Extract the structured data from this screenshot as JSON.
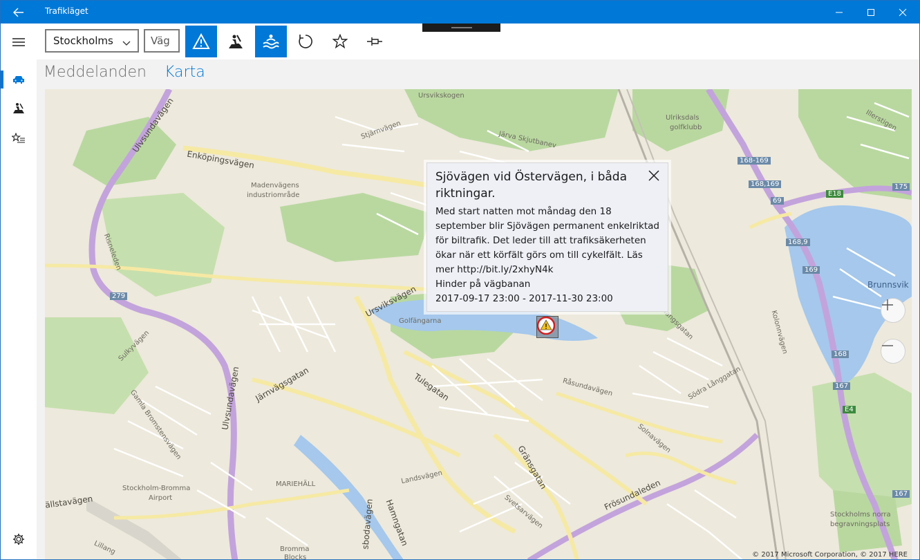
{
  "app": {
    "title": "Trafikläget"
  },
  "toolbar": {
    "region_value": "Stockholms",
    "road_placeholder": "Väg"
  },
  "tabs": [
    {
      "label": "Meddelanden",
      "selected": false
    },
    {
      "label": "Karta",
      "selected": true
    }
  ],
  "popup": {
    "title": "Sjövägen vid Östervägen, i båda riktningar.",
    "description": "Med start natten mot måndag den 18 september blir Sjövägen permanent enkelriktad för biltrafik. Det leder till att trafiksäkerheten ökar när ett körfält görs om till cykelfält. Läs mer http://bit.ly/2xhyN4k",
    "category": "Hinder på vägbanan",
    "period": "2017-09-17 23:00 - 2017-11-30 23:00"
  },
  "map": {
    "copyright": "© 2017 Microsoft Corporation, © 2017 HERE",
    "labels": {
      "ursvikskogen": "Ursvikskogen",
      "ulriksdals": "Ulriksdals",
      "golfklubb": "golfklubb",
      "illerstigen": "Illerstigen",
      "stjarnvagen": "Stjärnvägen",
      "jarva": "Järva Skjutbanev",
      "enkopingsvagen": "Enköpingsvägen",
      "ulvsundavagen_top": "Ulvsundavägen",
      "madenvagens": "Madenvägens",
      "industriomrade": "industriområde",
      "risnelleden": "Risneleden",
      "ursviksvagen": "Ursviksvägen",
      "golfangarna": "Golfängarna",
      "brunnsvik": "Brunnsvik",
      "kolonnvagen": "Kolonnvägen",
      "enangsgatan": "enangsgatan",
      "sulkyvagen": "Sulkyvägen",
      "ulvsundavagen": "Ulvsundavägen",
      "jarnvagsgatan": "Järnvägsgatan",
      "tulegatan": "Tulegatan",
      "rasundavagen": "Råsundavägen",
      "sodra_langgatan": "Södra Långgatan",
      "solnavagen": "Solnavägen",
      "gamla": "Gamla Bromstensvägen",
      "gransgatan": "Gränsgatan",
      "mariehall": "MARIEHÄLL",
      "landsvagen": "Landsvägen",
      "frosundaleden": "Frösundaleden",
      "svetsarvagen": "Svetsarvägen",
      "stockholm_bromma": "Stockholm-Bromma",
      "airport": "Airport",
      "allstavagen": "ällstavägen",
      "hamngatan": "Hamngatan",
      "sbodavagen": "sbodavägen",
      "bromma": "Bromma",
      "blocks": "Blocks",
      "lillang": "Lillang",
      "stockholms_norra": "Stockholms norra",
      "begravningsplats": "begravningsplats"
    },
    "shields": {
      "r279": "279",
      "r168_169": "168-169",
      "r168_169b": "168,169",
      "r69": "69",
      "e18": "E18",
      "r175": "175",
      "r168_9": "168,9",
      "r169": "169",
      "r168": "168",
      "r167": "167",
      "e4": "E4",
      "r167b": "167"
    }
  },
  "colors": {
    "accent": "#0078d7",
    "map_land": "#ede9dc",
    "map_park": "#b9d8a0",
    "map_water": "#a5c8ec",
    "motorway": "#c3a3dc",
    "major_road": "#f6e9a3"
  }
}
